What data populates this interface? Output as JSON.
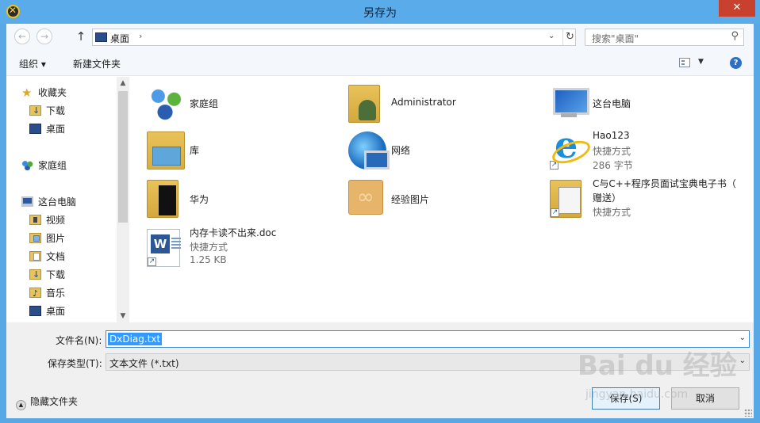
{
  "window": {
    "title": "另存为",
    "close": "✕"
  },
  "nav": {
    "back": "←",
    "forward": "→",
    "up": "↑"
  },
  "address": {
    "location": "桌面",
    "separator": "›",
    "dropdown": "⌄",
    "refresh": "↻"
  },
  "search": {
    "placeholder": "搜索\"桌面\"",
    "icon": "⚲"
  },
  "toolbar": {
    "organize": "组织 ▾",
    "new_folder": "新建文件夹",
    "view_dd": "▼",
    "help": "?"
  },
  "sidebar": {
    "items": [
      {
        "label": "收藏夹",
        "icon": "star-icon"
      },
      {
        "label": "下载",
        "icon": "downloads-folder-icon"
      },
      {
        "label": "桌面",
        "icon": "desktop-icon"
      },
      {
        "label": "家庭组",
        "icon": "homegroup-icon"
      },
      {
        "label": "这台电脑",
        "icon": "computer-icon"
      },
      {
        "label": "视频",
        "icon": "videos-folder-icon"
      },
      {
        "label": "图片",
        "icon": "pictures-folder-icon"
      },
      {
        "label": "文档",
        "icon": "documents-folder-icon"
      },
      {
        "label": "下载",
        "icon": "downloads-folder-icon"
      },
      {
        "label": "音乐",
        "icon": "music-folder-icon"
      },
      {
        "label": "桌面",
        "icon": "desktop-icon"
      }
    ],
    "scroll_up": "▲",
    "scroll_down": "▼"
  },
  "files": [
    {
      "name": "家庭组",
      "sub1": "",
      "sub2": "",
      "icon": "homegroup-icon"
    },
    {
      "name": "Administrator",
      "sub1": "",
      "sub2": "",
      "icon": "user-folder-icon"
    },
    {
      "name": "这台电脑",
      "sub1": "",
      "sub2": "",
      "icon": "computer-icon"
    },
    {
      "name": "库",
      "sub1": "",
      "sub2": "",
      "icon": "library-icon"
    },
    {
      "name": "网络",
      "sub1": "",
      "sub2": "",
      "icon": "network-icon"
    },
    {
      "name": "Hao123",
      "sub1": "快捷方式",
      "sub2": "286 字节",
      "icon": "ie-shortcut-icon"
    },
    {
      "name": "华为",
      "sub1": "",
      "sub2": "",
      "icon": "folder-icon"
    },
    {
      "name": "经验图片",
      "sub1": "",
      "sub2": "",
      "icon": "folder-icon"
    },
    {
      "name": "C与C++程序员面试宝典电子书（",
      "name2": "赠送）",
      "sub1": "快捷方式",
      "sub2": "",
      "icon": "folder-shortcut-icon"
    },
    {
      "name": "内存卡读不出来.doc",
      "sub1": "快捷方式",
      "sub2": "1.25 KB",
      "icon": "word-shortcut-icon"
    }
  ],
  "form": {
    "filename_label": "文件名(N):",
    "filename_value": "DxDiag.txt",
    "type_label": "保存类型(T):",
    "type_value": "文本文件 (*.txt)",
    "dropdown_arrow": "⌄"
  },
  "footer": {
    "hide_folders": "隐藏文件夹",
    "hide_icon": "▲",
    "save_button": "保存(S)",
    "cancel_button": "取消"
  },
  "watermark": {
    "main": "Bai du 经验",
    "sub": "jingyan.baidu.com"
  }
}
